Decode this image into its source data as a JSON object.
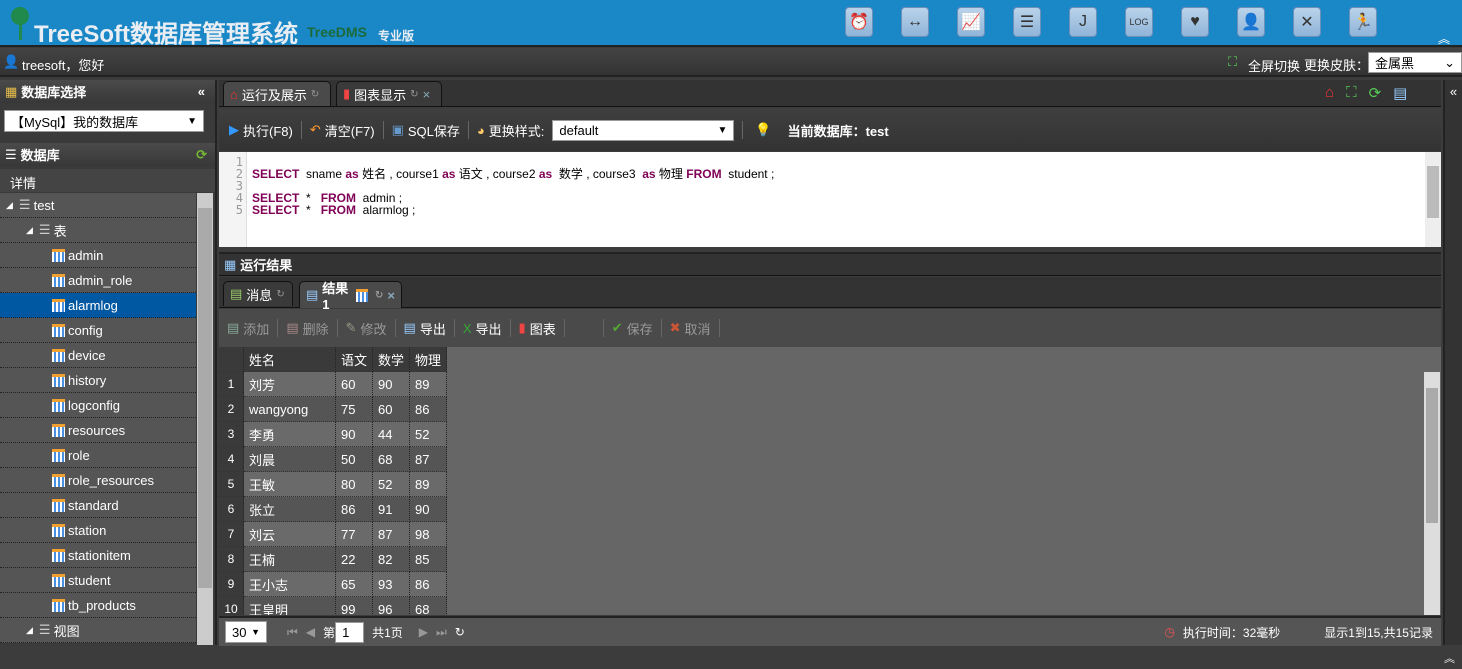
{
  "header": {
    "title": "TreeSoft数据库管理系统",
    "subtitle": "TreeDMS",
    "edition": "专业版",
    "icons": [
      "clock-icon",
      "arrows-icon",
      "chart-icon",
      "database-icon",
      "j-icon",
      "log-icon",
      "heart-icon",
      "user-icon",
      "tools-icon",
      "runner-icon"
    ]
  },
  "userbar": {
    "greeting": "treesoft，您好",
    "fullscreen": "全屏切换",
    "skin_label": "更换皮肤：",
    "skin_value": "金属黑"
  },
  "left": {
    "db_select_title": "数据库选择",
    "db_select_value": "【MySql】我的数据库",
    "db_title": "数据库",
    "detail": "详情",
    "tree": [
      {
        "label": "test",
        "level": 0,
        "type": "db"
      },
      {
        "label": "表",
        "level": 1,
        "type": "folder"
      },
      {
        "label": "admin",
        "level": 2
      },
      {
        "label": "admin_role",
        "level": 2
      },
      {
        "label": "alarmlog",
        "level": 2,
        "selected": true
      },
      {
        "label": "config",
        "level": 2
      },
      {
        "label": "device",
        "level": 2
      },
      {
        "label": "history",
        "level": 2
      },
      {
        "label": "logconfig",
        "level": 2
      },
      {
        "label": "resources",
        "level": 2
      },
      {
        "label": "role",
        "level": 2
      },
      {
        "label": "role_resources",
        "level": 2
      },
      {
        "label": "standard",
        "level": 2
      },
      {
        "label": "station",
        "level": 2
      },
      {
        "label": "stationitem",
        "level": 2
      },
      {
        "label": "student",
        "level": 2
      },
      {
        "label": "tb_products",
        "level": 2
      },
      {
        "label": "视图",
        "level": 1,
        "type": "folder"
      }
    ]
  },
  "tabs": [
    {
      "label": "运行及展示"
    },
    {
      "label": "图表显示"
    }
  ],
  "toolbar": {
    "run": "执行(F8)",
    "clear": "清空(F7)",
    "save": "SQL保存",
    "style_label": "更换样式:",
    "style_value": "default",
    "current_db": "当前数据库：test"
  },
  "editor": {
    "lines": [
      [],
      [
        [
          "kw",
          "SELECT"
        ],
        [
          "t",
          "  sname "
        ],
        [
          "kw",
          "as"
        ],
        [
          "t",
          " 姓名 , course1 "
        ],
        [
          "kw",
          "as"
        ],
        [
          "t",
          " 语文 , course2 "
        ],
        [
          "kw",
          "as"
        ],
        [
          "t",
          "  数学 , course3  "
        ],
        [
          "kw",
          "as"
        ],
        [
          "t",
          " 物理 "
        ],
        [
          "kw",
          "FROM"
        ],
        [
          "t",
          "  student ;"
        ]
      ],
      [],
      [
        [
          "kw",
          "SELECT"
        ],
        [
          "t",
          "  *   "
        ],
        [
          "kw",
          "FROM"
        ],
        [
          "t",
          "  admin ;"
        ]
      ],
      [
        [
          "kw",
          "SELECT"
        ],
        [
          "t",
          "  *   "
        ],
        [
          "kw",
          "FROM"
        ],
        [
          "t",
          "  alarmlog ;"
        ]
      ]
    ]
  },
  "results": {
    "title": "运行结果",
    "tabs": [
      {
        "label": "消息"
      },
      {
        "label": "结果1"
      }
    ],
    "actions": [
      {
        "label": "添加",
        "enabled": false
      },
      {
        "label": "删除",
        "enabled": false
      },
      {
        "label": "修改",
        "enabled": false
      },
      {
        "label": "导出",
        "enabled": true
      },
      {
        "label": "导出",
        "enabled": true
      },
      {
        "label": "图表",
        "enabled": true
      },
      {
        "label": "保存",
        "enabled": false
      },
      {
        "label": "取消",
        "enabled": false
      }
    ],
    "columns": [
      "姓名",
      "语文",
      "数学",
      "物理"
    ],
    "rows": [
      [
        "刘芳",
        "60",
        "90",
        "89"
      ],
      [
        "wangyong",
        "75",
        "60",
        "86"
      ],
      [
        "李勇",
        "90",
        "44",
        "52"
      ],
      [
        "刘晨",
        "50",
        "68",
        "87"
      ],
      [
        "王敏",
        "80",
        "52",
        "89"
      ],
      [
        "张立",
        "86",
        "91",
        "90"
      ],
      [
        "刘云",
        "77",
        "87",
        "98"
      ],
      [
        "王楠",
        "22",
        "82",
        "85"
      ],
      [
        "王小志",
        "65",
        "93",
        "86"
      ],
      [
        "王皇明",
        "99",
        "96",
        "68"
      ]
    ]
  },
  "pager": {
    "page_size": "30",
    "page_prefix": "第",
    "page": "1",
    "page_suffix": "共1页",
    "exec_time": "执行时间：32毫秒",
    "summary": "显示1到15,共15记录"
  }
}
